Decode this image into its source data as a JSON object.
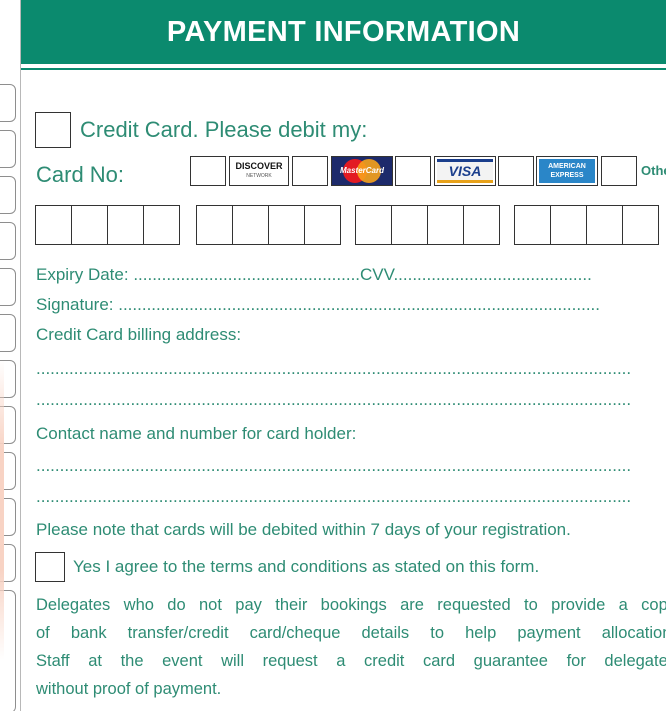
{
  "header": {
    "title": "PAYMENT INFORMATION"
  },
  "colors": {
    "brand": "#0b8a6e",
    "text": "#2e8c74",
    "accent_strip": "#f8d3c4"
  },
  "credit_card": {
    "checkbox_label": "Credit Card. Please debit my:",
    "card_no_label": "Card No:",
    "card_types": [
      {
        "name": "DISCOVER",
        "sub": "NETWORK"
      },
      {
        "name": "MasterCard"
      },
      {
        "name": "VISA"
      },
      {
        "name": "AMERICAN",
        "sub": "EXPRESS"
      },
      {
        "name": "Other"
      }
    ]
  },
  "fields": {
    "expiry_label": "Expiry Date: ",
    "expiry_dots": "................................................",
    "cvv_label": "CVV",
    "cvv_dots": "..........................................",
    "signature_label": "Signature: ",
    "signature_dots": "......................................................................................................",
    "billing_label": "Credit Card billing address:",
    "billing_line1": "..............................................................................................................................",
    "billing_line2": "..............................................................................................................................",
    "contact_label": "Contact name and number for card holder:",
    "contact_line1": "..............................................................................................................................",
    "contact_line2": ".............................................................................................................................."
  },
  "notes": {
    "debit_note": "Please note that cards will be debited within 7 days of your registration.",
    "agree_label": "Yes I agree to the terms and conditions as stated on this form.",
    "delegates_line1": "Delegates who do not pay their bookings are requested to provide a copy",
    "delegates_line2": "of bank transfer/credit card/cheque details to help payment allocation.",
    "delegates_line3": "Staff at the event will request a credit card guarantee for delegates",
    "delegates_line4": "without proof of payment."
  }
}
